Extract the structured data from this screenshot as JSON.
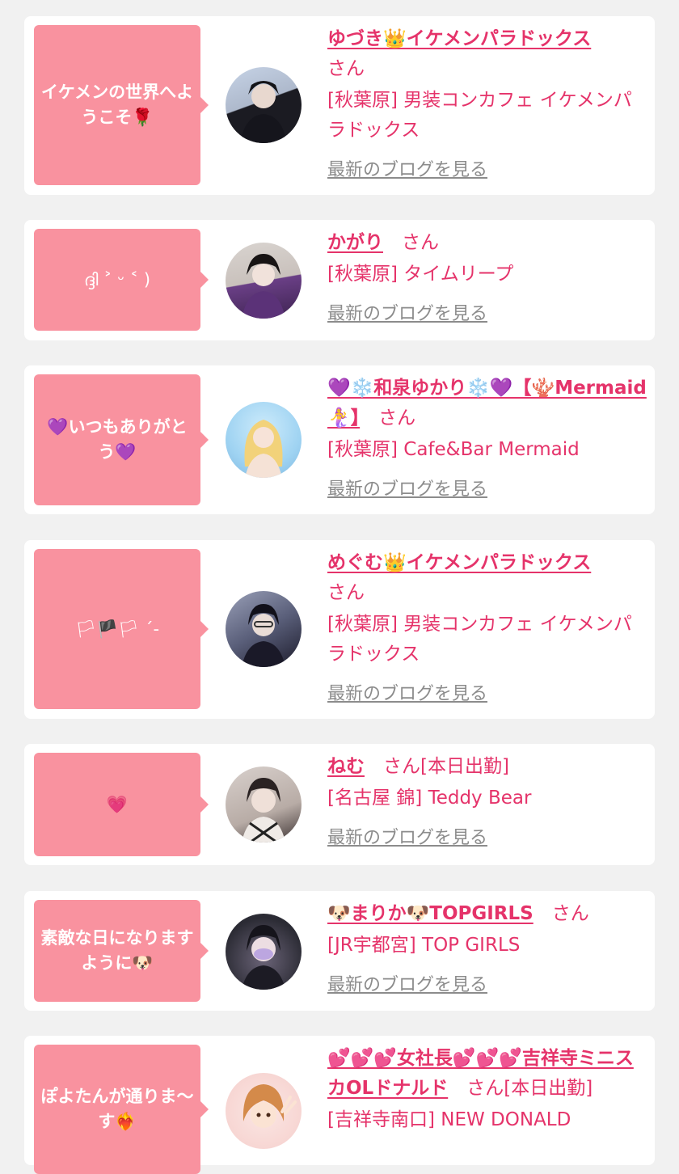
{
  "blog_link_label": "最新のブログを見る",
  "cards": [
    {
      "bubble": "イケメンの世界へようこそ🌹",
      "name": "ゆづき👑イケメンパラドックス",
      "suffix": "さん",
      "shop": "[秋葉原] 男装コンカフェ イケメンパラドックス",
      "avatar_colors": [
        "#c6d3e6",
        "#1b1b22"
      ]
    },
    {
      "bubble": "ദ്ദി ˃ ᵕ ˂ )",
      "name": "かがり",
      "suffix": "さん",
      "shop": "[秋葉原] タイムリープ",
      "avatar_colors": [
        "#d9d4d0",
        "#6a3f86"
      ]
    },
    {
      "bubble": "💜いつもありがとう💜",
      "name": "💜❄️和泉ゆかり❄️💜【🪸Mermaid🧜‍♀️】",
      "suffix": "さん",
      "shop": "[秋葉原] Cafe&Bar Mermaid",
      "avatar_colors": [
        "#9fd3f2",
        "#f2d27a"
      ]
    },
    {
      "bubble": "🏳🏴🏳 ˊ-",
      "name": "めぐむ👑イケメンパラドックス",
      "suffix": "さん",
      "shop": "[秋葉原] 男装コンカフェ イケメンパラドックス",
      "avatar_colors": [
        "#9aa0b8",
        "#1d1c2c"
      ]
    },
    {
      "bubble": "💗",
      "name": "ねむ",
      "suffix": "さん[本日出勤]",
      "shop": "[名古屋 錦] Teddy Bear",
      "avatar_colors": [
        "#d8d0cc",
        "#3a3030"
      ]
    },
    {
      "bubble": "素敵な日になりますように🐶",
      "name": "🐶まりか🐶TOPGIRLS",
      "suffix": "さん",
      "shop": "[JR宇都宮] TOP GIRLS",
      "avatar_colors": [
        "#2b2b34",
        "#b7a0e0"
      ]
    },
    {
      "bubble": "ぽよたんが通りま〜す❤️‍🔥",
      "name": "💕💕💕女社長💕💕💕吉祥寺ミニスカOLドナルド",
      "suffix": "さん[本日出勤]",
      "shop": "[吉祥寺南口] NEW DONALD",
      "avatar_colors": [
        "#f7d6d3",
        "#d48a4a"
      ]
    }
  ]
}
